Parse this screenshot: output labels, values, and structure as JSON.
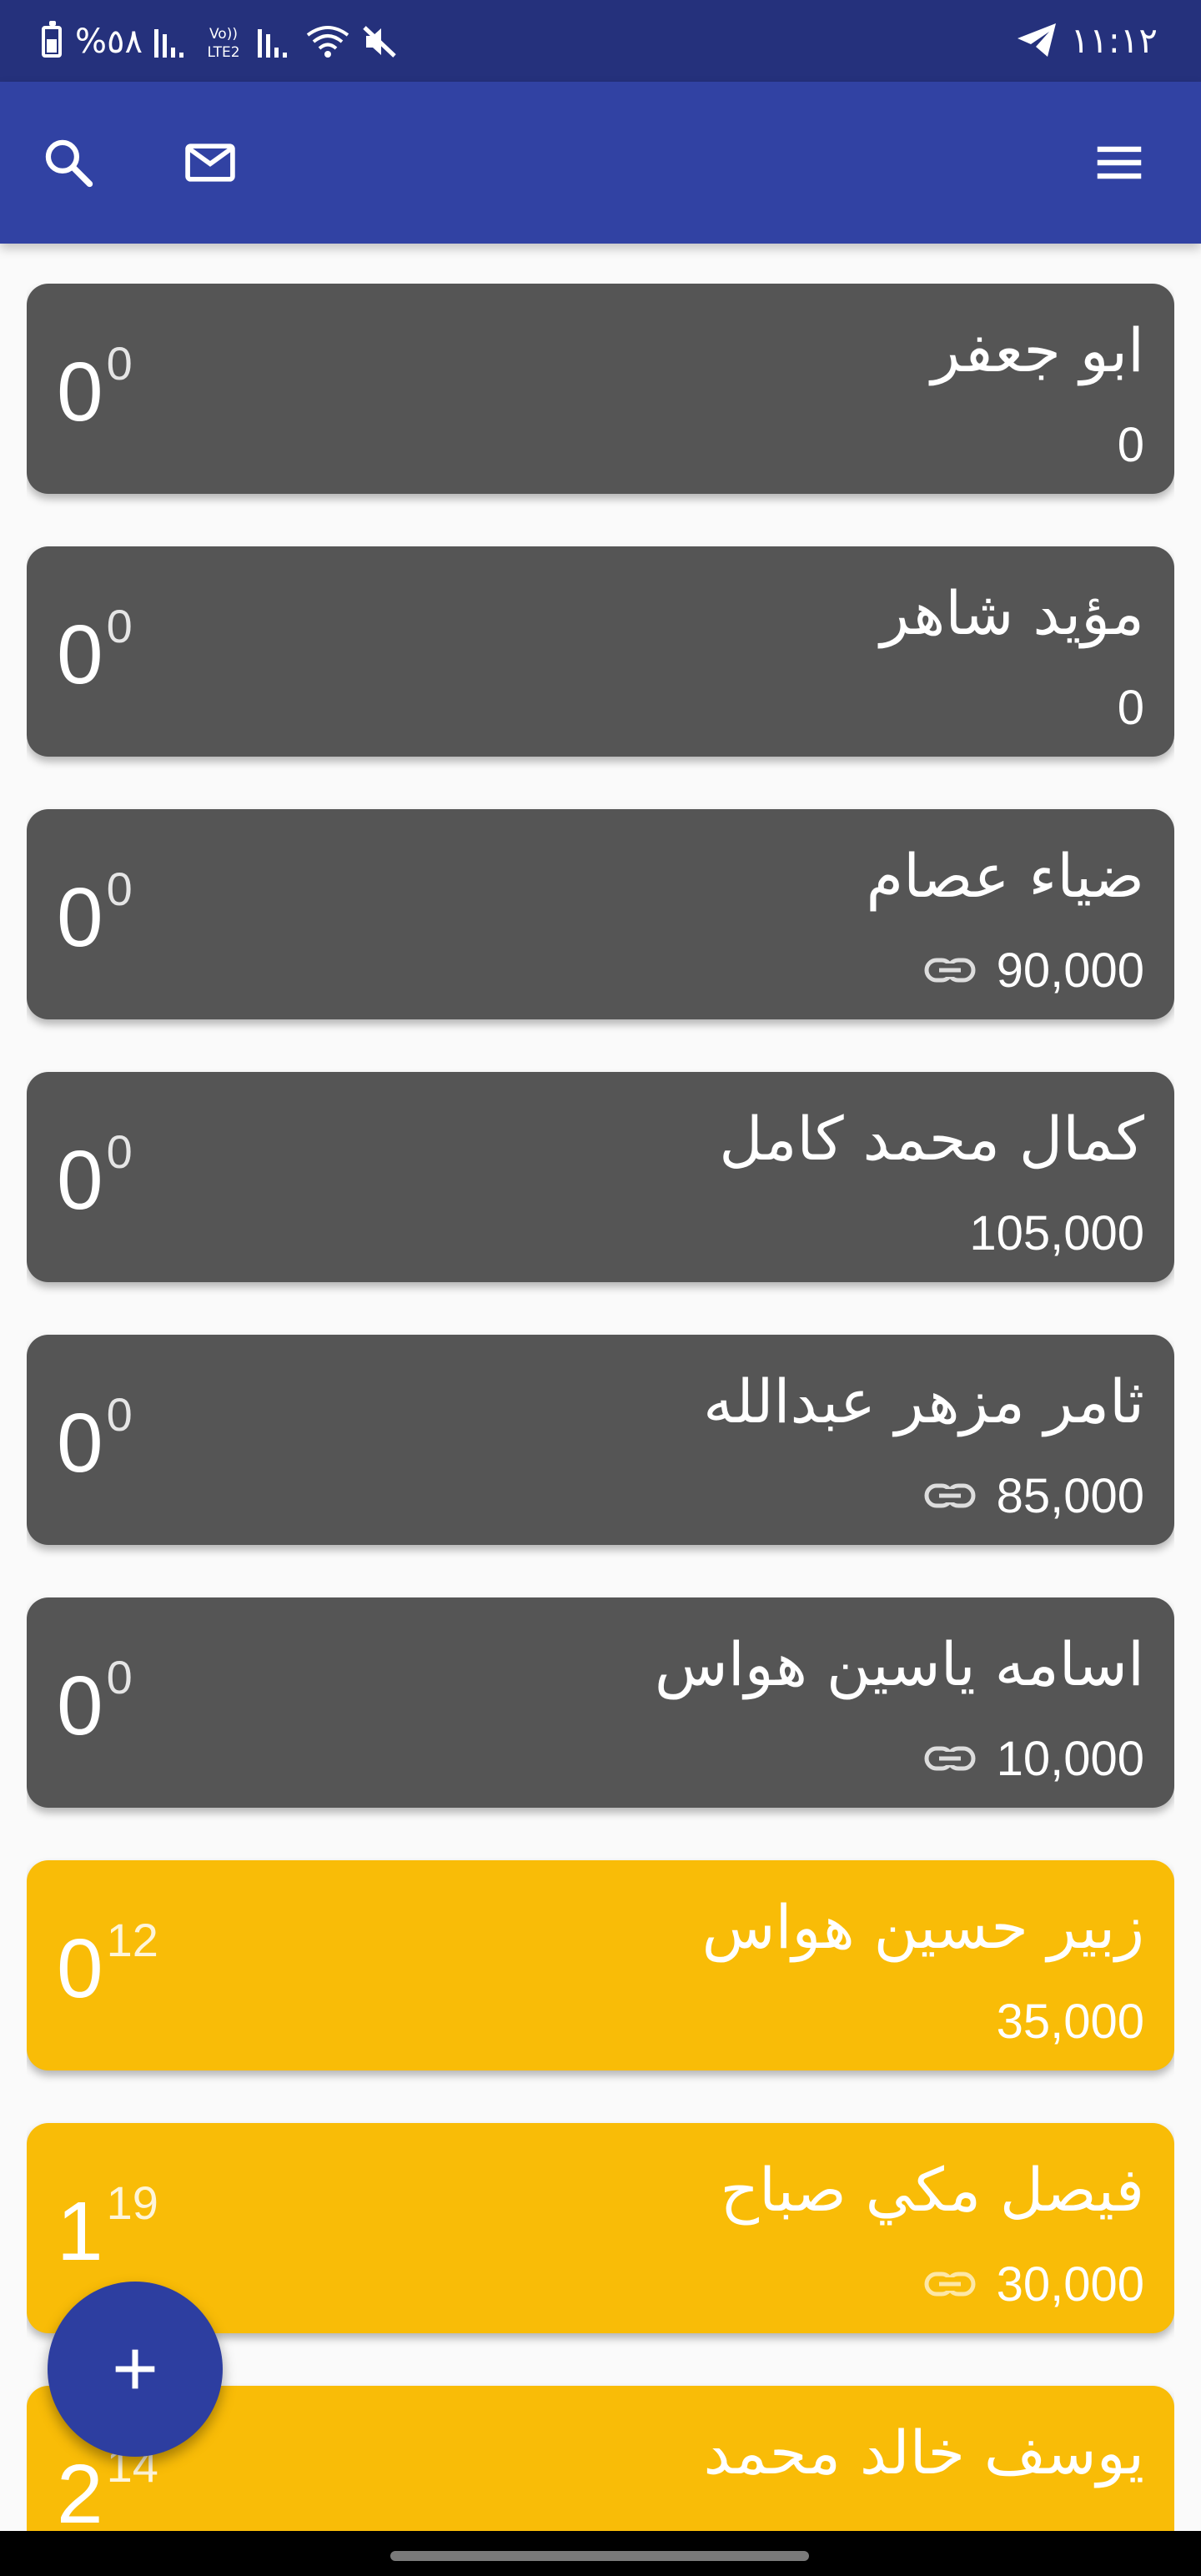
{
  "status_bar": {
    "battery_text": "%٥٨",
    "volte_label": "Vo))\nLTE2",
    "time": "١١:١٢"
  },
  "app_bar": {
    "search_icon": "search-icon",
    "mail_icon": "mail-icon",
    "menu_icon": "menu-icon",
    "background": "#3142a3"
  },
  "cards": [
    {
      "name": "ابو جعفر",
      "amount": "0",
      "linked": false,
      "count": "0",
      "count_sup": "0",
      "color": "gray"
    },
    {
      "name": "مؤيد شاهر",
      "amount": "0",
      "linked": false,
      "count": "0",
      "count_sup": "0",
      "color": "gray"
    },
    {
      "name": "ضياء عصام",
      "amount": "90,000",
      "linked": true,
      "count": "0",
      "count_sup": "0",
      "color": "gray"
    },
    {
      "name": "كمال محمد كامل",
      "amount": "105,000",
      "linked": false,
      "count": "0",
      "count_sup": "0",
      "color": "gray"
    },
    {
      "name": "ثامر مزهر عبدالله",
      "amount": "85,000",
      "linked": true,
      "count": "0",
      "count_sup": "0",
      "color": "gray"
    },
    {
      "name": "اسامه ياسين هواس",
      "amount": "10,000",
      "linked": true,
      "count": "0",
      "count_sup": "0",
      "color": "gray"
    },
    {
      "name": "زبير حسين هواس",
      "amount": "35,000",
      "linked": false,
      "count": "0",
      "count_sup": "12",
      "color": "amber"
    },
    {
      "name": "فيصل مكي صباح",
      "amount": "30,000",
      "linked": true,
      "count": "1",
      "count_sup": "19",
      "color": "amber"
    },
    {
      "name": "يوسف خالد محمد",
      "amount": "",
      "linked": false,
      "count": "2",
      "count_sup": "14",
      "color": "amber"
    }
  ],
  "colors": {
    "gray_card": "#555555",
    "amber_card": "#f9bc07",
    "fab": "#2d3ea0"
  },
  "fab": {
    "icon": "plus-icon"
  }
}
